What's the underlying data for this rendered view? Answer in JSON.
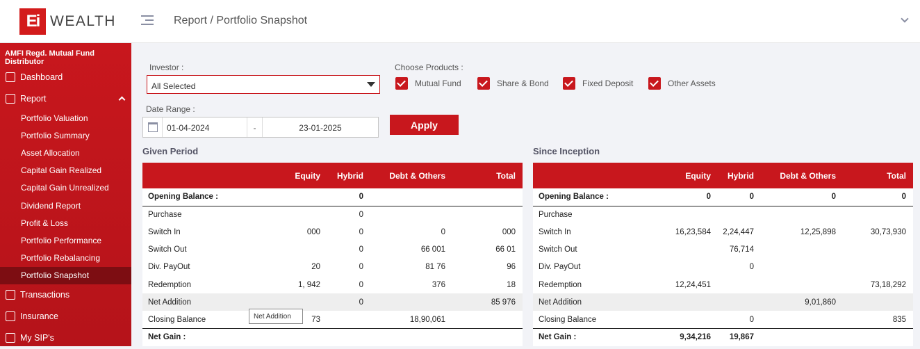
{
  "header": {
    "logo_mark": "Ei",
    "logo_text": "WEALTH",
    "breadcrumb": "Report / Portfolio Snapshot",
    "user_label": ""
  },
  "sidebar": {
    "title": "AMFI Regd. Mutual Fund Distributor",
    "dashboard": "Dashboard",
    "report": "Report",
    "report_items": [
      "Portfolio Valuation",
      "Portfolio Summary",
      "Asset Allocation",
      "Capital Gain Realized",
      "Capital Gain Unrealized",
      "Dividend Report",
      "Profit & Loss",
      "Portfolio Performance",
      "Portfolio Rebalancing",
      "Portfolio Snapshot"
    ],
    "transactions": "Transactions",
    "insurance": "Insurance",
    "my_sips": "My SIP's"
  },
  "filters": {
    "investor_label": "Investor :",
    "investor_value": "All Selected",
    "products_label": "Choose Products :",
    "products": [
      "Mutual Fund",
      "Share & Bond",
      "Fixed Deposit",
      "Other Assets"
    ],
    "date_label": "Date Range :",
    "date_from": "01-04-2024",
    "date_sep": "-",
    "date_to": "23-01-2025",
    "apply": "Apply"
  },
  "given_period": {
    "title": "Given Period",
    "headers": [
      "",
      "Equity",
      "Hybrid",
      "Debt & Others",
      "Total"
    ],
    "rows": [
      [
        "Opening Balance :",
        "",
        "0",
        "",
        ""
      ],
      [
        "Purchase",
        "",
        "0",
        "",
        ""
      ],
      [
        "Switch In",
        "000",
        "0",
        "0",
        "000"
      ],
      [
        "Switch Out",
        "",
        "0",
        "66 001",
        "66 01"
      ],
      [
        "Div. PayOut",
        "20",
        "0",
        "81 76",
        "96"
      ],
      [
        "Redemption",
        "1, 942",
        "0",
        "376",
        "18"
      ],
      [
        "Net Addition",
        "",
        "0",
        "",
        "85 976"
      ],
      [
        "Closing Balance",
        "73",
        "",
        "18,90,061",
        ""
      ],
      [
        "Net Gain :",
        "",
        "",
        "",
        ""
      ]
    ]
  },
  "since_inception": {
    "title": "Since Inception",
    "headers": [
      "",
      "Equity",
      "Hybrid",
      "Debt & Others",
      "Total"
    ],
    "rows": [
      [
        "Opening Balance :",
        "0",
        "0",
        "0",
        "0"
      ],
      [
        "Purchase",
        "",
        "",
        "",
        ""
      ],
      [
        "Switch In",
        "16,23,584",
        "2,24,447",
        "12,25,898",
        "30,73,930"
      ],
      [
        "Switch Out",
        "",
        "76,714",
        "",
        ""
      ],
      [
        "Div. PayOut",
        "",
        "0",
        "",
        ""
      ],
      [
        "Redemption",
        "12,24,451",
        "",
        "",
        "73,18,292"
      ],
      [
        "Net Addition",
        "",
        "",
        "9,01,860",
        ""
      ],
      [
        "Closing Balance",
        "",
        "0",
        "",
        "835"
      ],
      [
        "Net Gain :",
        "9,34,216",
        "19,867",
        "",
        ""
      ]
    ]
  },
  "tooltip": "Net Addition"
}
